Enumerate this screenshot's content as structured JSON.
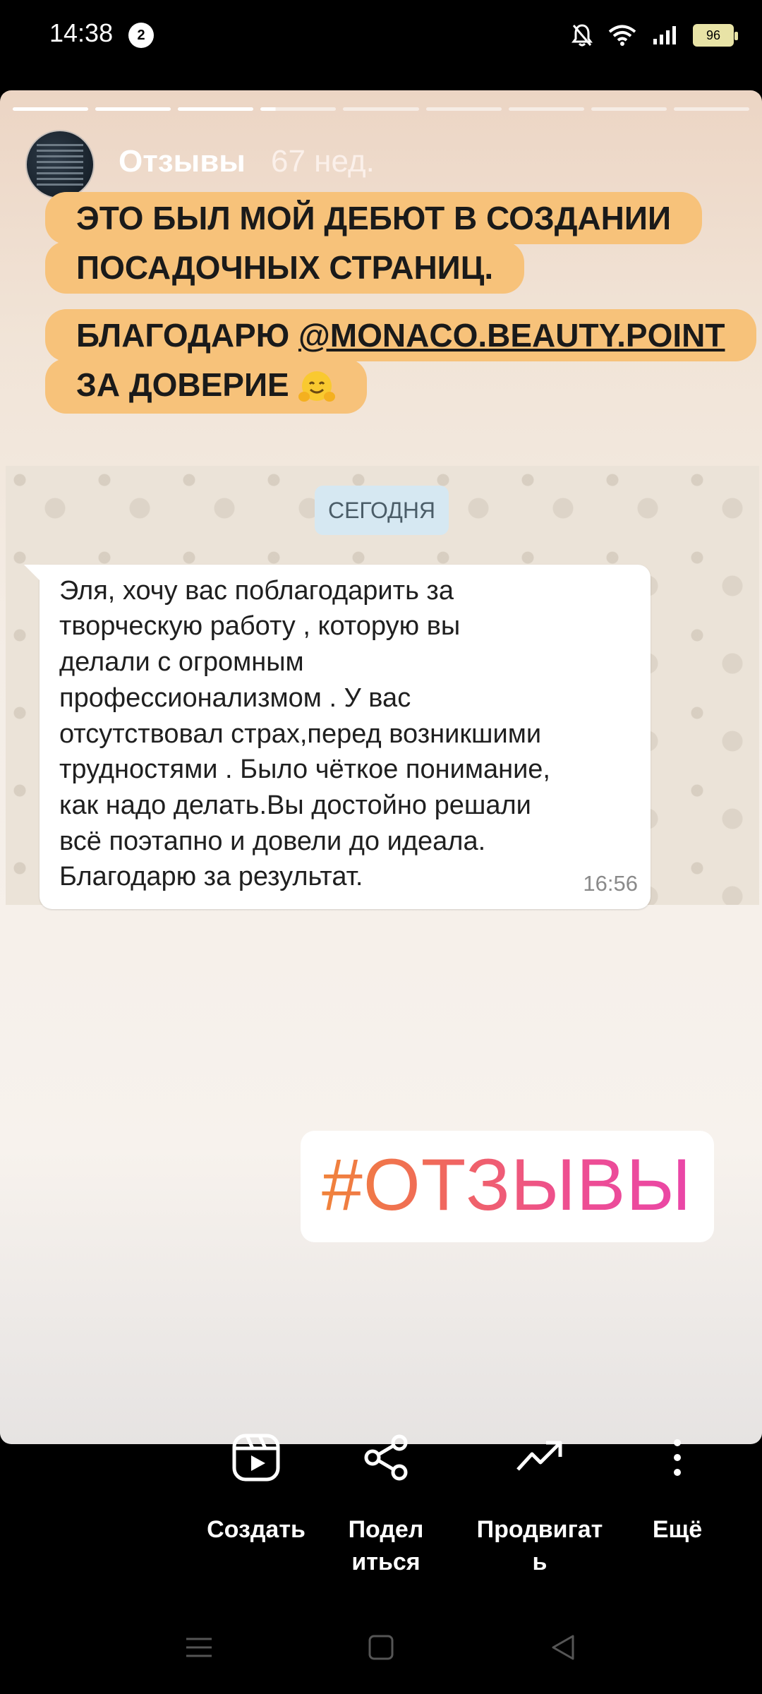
{
  "status_bar": {
    "time": "14:38",
    "notification_count": "2",
    "battery": "96",
    "icons": [
      "bell-off-icon",
      "wifi-icon",
      "signal-icon",
      "battery-icon"
    ]
  },
  "story": {
    "account_name": "Отзывы",
    "posted_ago": "67 нед.",
    "progress": {
      "segments": 9,
      "current_index": 3,
      "current_fraction": 0.2
    },
    "caption_1": [
      "ЭТО БЫЛ МОЙ ДЕБЮТ В СОЗДАНИИ",
      "ПОСАДОЧНЫХ СТРАНИЦ."
    ],
    "caption_2": {
      "line1_prefix": "БЛАГОДАРЮ ",
      "mention": "@MONACO.BEAUTY.POINT",
      "line2": "ЗА ДОВЕРИЕ",
      "emoji": "hugging-face-emoji"
    },
    "chat": {
      "date_chip": "СЕГОДНЯ",
      "message_lines": [
        "Эля, хочу вас поблагодарить за",
        "творческую работу , которую вы",
        "делали с огромным",
        "профессионализмом . У вас",
        "отсутствовал страх,перед возникшими",
        "трудностями . Было чёткое понимание,",
        "как надо делать.Вы достойно решали",
        "всё поэтапно и довели до идеала.",
        "Благодарю за результат."
      ],
      "message_time": "16:56"
    },
    "hashtag": "#ОТЗЫВЫ"
  },
  "actions": {
    "create": {
      "label": "Создать",
      "icon": "reels-icon"
    },
    "share": {
      "label_lines": [
        "Подел",
        "иться"
      ],
      "icon": "share-icon"
    },
    "promote": {
      "label_lines": [
        "Продвигат",
        "ь"
      ],
      "icon": "trending-up-icon"
    },
    "more": {
      "label": "Ещё",
      "icon": "more-vertical-icon"
    }
  },
  "nav": [
    "menu-icon",
    "home-square-icon",
    "back-triangle-icon"
  ]
}
